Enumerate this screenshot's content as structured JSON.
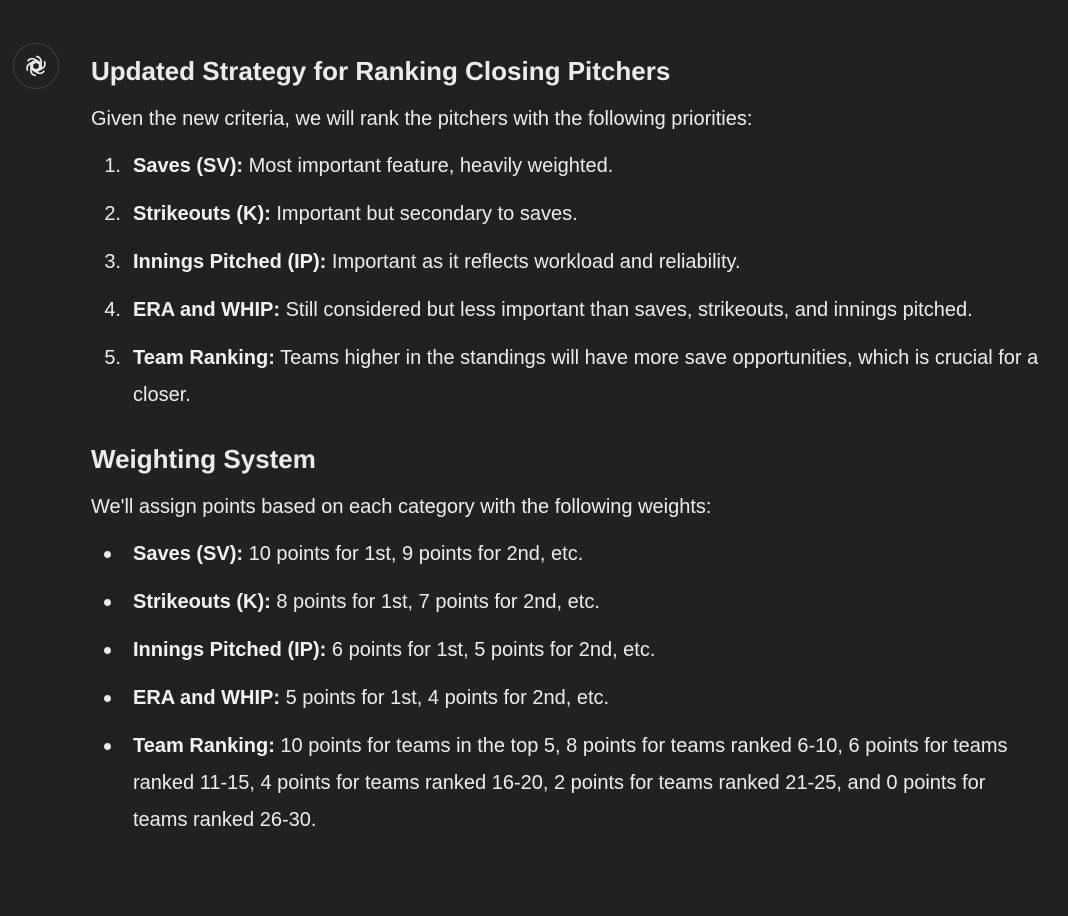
{
  "message": {
    "assistant_icon": "openai-logo-icon",
    "section1": {
      "heading": "Updated Strategy for Ranking Closing Pitchers",
      "intro": "Given the new criteria, we will rank the pitchers with the following priorities:",
      "items": [
        {
          "num": "1.",
          "label": "Saves (SV):",
          "text": " Most important feature, heavily weighted."
        },
        {
          "num": "2.",
          "label": "Strikeouts (K):",
          "text": " Important but secondary to saves."
        },
        {
          "num": "3.",
          "label": "Innings Pitched (IP):",
          "text": " Important as it reflects workload and reliability."
        },
        {
          "num": "4.",
          "label": "ERA and WHIP:",
          "text": " Still considered but less important than saves, strikeouts, and innings pitched."
        },
        {
          "num": "5.",
          "label": "Team Ranking:",
          "text": " Teams higher in the standings will have more save opportunities, which is crucial for a closer."
        }
      ]
    },
    "section2": {
      "heading": "Weighting System",
      "intro": "We'll assign points based on each category with the following weights:",
      "items": [
        {
          "label": "Saves (SV):",
          "text": " 10 points for 1st, 9 points for 2nd, etc."
        },
        {
          "label": "Strikeouts (K):",
          "text": " 8 points for 1st, 7 points for 2nd, etc."
        },
        {
          "label": "Innings Pitched (IP):",
          "text": " 6 points for 1st, 5 points for 2nd, etc."
        },
        {
          "label": "ERA and WHIP:",
          "text": " 5 points for 1st, 4 points for 2nd, etc."
        },
        {
          "label": "Team Ranking:",
          "text": " 10 points for teams in the top 5, 8 points for teams ranked 6-10, 6 points for teams ranked 11-15, 4 points for teams ranked 16-20, 2 points for teams ranked 21-25, and 0 points for teams ranked 26-30."
        }
      ]
    }
  }
}
